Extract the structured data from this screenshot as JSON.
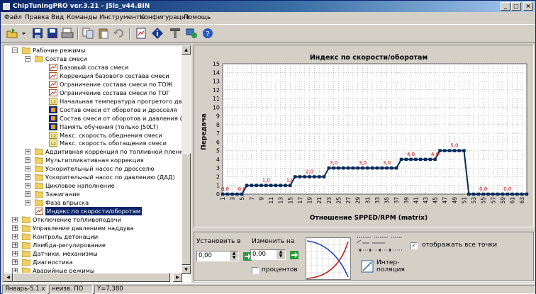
{
  "window": {
    "title": "ChipTuningPRO ver.3.21 - j5ls_v44.BIN"
  },
  "menu": [
    "Файл",
    "Правка",
    "Вид",
    "Команды",
    "Инструменты",
    "Конфигурация",
    "Помощь"
  ],
  "toolbar": {
    "icons": [
      "open-icon",
      "dropdown-arrow-icon",
      "save-icon",
      "save-as-icon",
      "print-icon",
      "copy-icon",
      "paste-icon",
      "undo-icon",
      "document-icon",
      "info-icon",
      "tools-icon",
      "network-icon",
      "help-icon"
    ]
  },
  "tree": {
    "items": [
      {
        "label": "Рабочие режимы",
        "level": 1,
        "expander": "−",
        "icon": "folder-open-icon"
      },
      {
        "label": "Состав смеси",
        "level": 2,
        "expander": "−",
        "icon": "folder-open-icon"
      },
      {
        "label": "Базовый состав смеси",
        "level": 3,
        "icon": "table-icon"
      },
      {
        "label": "Коррекция базового состава смеси",
        "level": 3,
        "icon": "table-icon"
      },
      {
        "label": "Ограничение состава смеси по ТОЖ",
        "level": 3,
        "icon": "table-icon"
      },
      {
        "label": "Ограничение состава смеси по ТОГ",
        "level": 3,
        "icon": "table-icon"
      },
      {
        "label": "Начальная температура прогретого двигателя",
        "level": 3,
        "icon": "constant-icon"
      },
      {
        "label": "Состав смеси от оборотов и дросселя",
        "level": 3,
        "icon": "map-icon"
      },
      {
        "label": "Состав смеси от оборотов и давления (turbo)",
        "level": 3,
        "icon": "map-icon"
      },
      {
        "label": "Память обучения (только J50LT)",
        "level": 3,
        "icon": "map-icon"
      },
      {
        "label": "Макс. скорость обеднения смеси",
        "level": 3,
        "icon": "constant-icon"
      },
      {
        "label": "Макс. скорость обогащения смеси",
        "level": 3,
        "icon": "constant-icon"
      },
      {
        "label": "Аддитивная коррекция по топливной пленке",
        "level": 2,
        "expander": "+",
        "icon": "folder-icon"
      },
      {
        "label": "Мультипликативная коррекция",
        "level": 2,
        "expander": "+",
        "icon": "folder-icon"
      },
      {
        "label": "Ускорительный насос по дросселю",
        "level": 2,
        "expander": "+",
        "icon": "folder-icon"
      },
      {
        "label": "Ускорительный насос по давлению (ДАД)",
        "level": 2,
        "expander": "+",
        "icon": "folder-icon"
      },
      {
        "label": "Цикловое наполнение",
        "level": 2,
        "expander": "+",
        "icon": "folder-icon"
      },
      {
        "label": "Зажигание",
        "level": 2,
        "expander": "+",
        "icon": "folder-icon"
      },
      {
        "label": "Фаза впрыска",
        "level": 2,
        "expander": "+",
        "icon": "folder-icon"
      },
      {
        "label": "Индекс по скорости/оборотам",
        "level": 2,
        "icon": "table-icon",
        "selected": true
      },
      {
        "label": "Отключение топливоподачи",
        "level": 1,
        "expander": "+",
        "icon": "folder-icon"
      },
      {
        "label": "Управление давлением наддува",
        "level": 1,
        "expander": "+",
        "icon": "folder-icon"
      },
      {
        "label": "Контроль детонации",
        "level": 1,
        "expander": "+",
        "icon": "folder-icon"
      },
      {
        "label": "Лямбда-регулирование",
        "level": 1,
        "expander": "+",
        "icon": "folder-icon"
      },
      {
        "label": "Датчики, механизмы",
        "level": 1,
        "expander": "+",
        "icon": "folder-icon"
      },
      {
        "label": "Диагностика",
        "level": 1,
        "expander": "+",
        "icon": "folder-icon"
      },
      {
        "label": "Аварийные режимы",
        "level": 1,
        "expander": "+",
        "icon": "folder-icon"
      }
    ]
  },
  "chart_data": {
    "type": "line",
    "title": "Индекс по скорости/оборотам",
    "xlabel": "Отношение SPPED/RPM (matrix)",
    "ylabel": "Передача",
    "ylim": [
      0,
      15
    ],
    "xlim": [
      1,
      64
    ],
    "yticks": [
      "0",
      "1",
      "2",
      "3",
      "4",
      "5",
      "6",
      "7",
      "8",
      "9",
      "10",
      "11",
      "12",
      "13",
      "14",
      "15"
    ],
    "xticks": [
      "1",
      "3",
      "5",
      "7",
      "9",
      "11",
      "13",
      "15",
      "17",
      "19",
      "21",
      "23",
      "25",
      "27",
      "29",
      "31",
      "33",
      "35",
      "37",
      "39",
      "41",
      "43",
      "45",
      "47",
      "49",
      "51",
      "53",
      "55",
      "57",
      "59",
      "61",
      "63"
    ],
    "x": [
      1,
      2,
      3,
      4,
      5,
      6,
      7,
      8,
      9,
      10,
      11,
      12,
      13,
      14,
      15,
      16,
      17,
      18,
      19,
      20,
      21,
      22,
      23,
      24,
      25,
      26,
      27,
      28,
      29,
      30,
      31,
      32,
      33,
      34,
      35,
      36,
      37,
      38,
      39,
      40,
      41,
      42,
      43,
      44,
      45,
      46,
      47,
      48,
      49,
      50,
      51,
      52,
      53,
      54,
      55,
      56,
      57,
      58,
      59,
      60,
      61,
      62,
      63,
      64
    ],
    "y": [
      0,
      0,
      0,
      0,
      0,
      1,
      1,
      1,
      1,
      1,
      1,
      1,
      1,
      1,
      1,
      2,
      2,
      2,
      2,
      2,
      2,
      2,
      3,
      3,
      3,
      3,
      3,
      3,
      3,
      3,
      3,
      3,
      3,
      3,
      3,
      3,
      3,
      4,
      4,
      4,
      4,
      4,
      4,
      4,
      4,
      5,
      5,
      5,
      5,
      5,
      5,
      0,
      0,
      0,
      0,
      0,
      0,
      0,
      0,
      0,
      0,
      0,
      0,
      0
    ],
    "data_labels": [
      {
        "x": 1.5,
        "y": 0,
        "text": "0,0"
      },
      {
        "x": 5,
        "y": 0,
        "text": "0,0"
      },
      {
        "x": 10,
        "y": 1,
        "text": "1,0"
      },
      {
        "x": 15,
        "y": 1,
        "text": "1,0"
      },
      {
        "x": 19,
        "y": 2,
        "text": "2,0"
      },
      {
        "x": 24,
        "y": 3,
        "text": "3,0"
      },
      {
        "x": 30,
        "y": 3,
        "text": "3,0"
      },
      {
        "x": 35,
        "y": 3,
        "text": "3,0"
      },
      {
        "x": 40,
        "y": 4,
        "text": "4,0"
      },
      {
        "x": 45,
        "y": 4,
        "text": "4,0"
      },
      {
        "x": 49,
        "y": 5,
        "text": "5,0"
      },
      {
        "x": 55,
        "y": 0,
        "text": "0,0"
      },
      {
        "x": 60,
        "y": 0,
        "text": "0,0"
      }
    ],
    "grid": true,
    "line_color": "#0a2b5a",
    "label_color": "#cc0000"
  },
  "controls": {
    "set_label": "Установить в",
    "set_value": "0,00",
    "change_label": "Изменить на",
    "change_value": "0,00",
    "percent_label": "процентов",
    "interp_label": "Интер-\nполяция",
    "show_points_label": "отображать все точки",
    "show_points_checked": true,
    "percent_checked": false
  },
  "status": {
    "s1": "Январь-5.1.x",
    "s2": "неизв. ПО",
    "s3": "Y=7,380"
  }
}
